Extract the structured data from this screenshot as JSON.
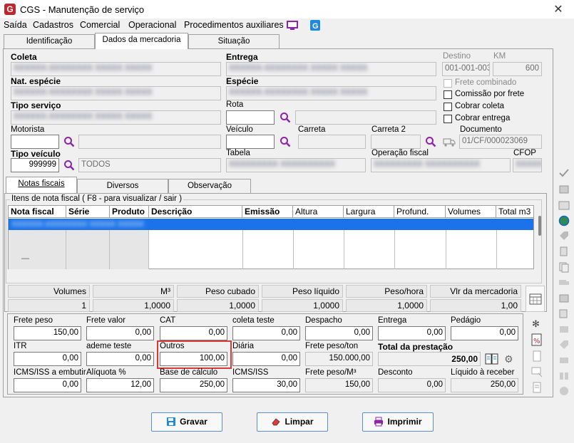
{
  "window": {
    "title": "CGS - Manutenção de serviço",
    "close": "✕",
    "app_icon_letter": "G"
  },
  "menu": [
    "Saída",
    "Cadastros",
    "Comercial",
    "Operacional",
    "Procedimentos auxiliares"
  ],
  "tabs_top": [
    "Identificação",
    "Dados da mercadoria",
    "Situação"
  ],
  "fields": {
    "coleta": "Coleta",
    "entrega": "Entrega",
    "destino": "Destino",
    "destino_value": "001-001-003",
    "km": "KM",
    "km_value": "600",
    "nat_especie": "Nat. espécie",
    "especie": "Espécie",
    "tipo_servico": "Tipo serviço",
    "rota": "Rota",
    "motorista": "Motorista",
    "veiculo": "Veículo",
    "carreta": "Carreta",
    "carreta2": "Carreta 2",
    "documento": "Documento",
    "documento_value": "01/CF/000023069",
    "tipo_veiculo": "Tipo veículo",
    "tipo_veiculo_code": "999999",
    "tipo_veiculo_desc": "TODOS",
    "tabela": "Tabela",
    "operacao_fiscal": "Operação fiscal",
    "cfop": "CFOP"
  },
  "checks": [
    "Frete combinado",
    "Comissão por frete",
    "Cobrar coleta",
    "Cobrar entrega"
  ],
  "tabs_mid": [
    "Notas fiscais",
    "Diversos",
    "Observação"
  ],
  "group_title": "Itens de nota fiscal ( F8 - para visualizar / sair )",
  "grid_headers": [
    "Nota fiscal",
    "Série",
    "Produto",
    "Descrição",
    "Emissão",
    "Altura",
    "Largura",
    "Profund.",
    "Volumes",
    "Total m3"
  ],
  "grid_footer": "—",
  "summary": {
    "labels": [
      "Volumes",
      "M³",
      "Peso cubado",
      "Peso líquido",
      "Peso/hora",
      "Vlr da mercadoria"
    ],
    "values": [
      "1",
      "1,0000",
      "1,0000",
      "1,0000",
      "1,0000",
      "1,00"
    ]
  },
  "charges": {
    "frete_peso": {
      "label": "Frete peso",
      "value": "150,00"
    },
    "frete_valor": {
      "label": "Frete valor",
      "value": "0,00"
    },
    "cat": {
      "label": "CAT",
      "value": "0,00"
    },
    "coleta_teste": {
      "label": "coleta teste",
      "value": "0,00"
    },
    "despacho": {
      "label": "Despacho",
      "value": "0,00"
    },
    "entrega": {
      "label": "Entrega",
      "value": "0,00"
    },
    "pedagio": {
      "label": "Pedágio",
      "value": "0,00"
    },
    "itr": {
      "label": "ITR",
      "value": "0,00"
    },
    "ademe_teste": {
      "label": "ademe teste",
      "value": "0,00"
    },
    "outros": {
      "label": "Outros",
      "value": "100,00"
    },
    "diaria": {
      "label": "Diária",
      "value": "0,00"
    },
    "frete_peso_ton": {
      "label": "Frete peso/ton",
      "value": "150.000,00"
    },
    "total_prestacao": {
      "label": "Total da prestação",
      "value": "250,00"
    },
    "icms_embutir": {
      "label": "ICMS/ISS a embutir",
      "value": "0,00"
    },
    "aliquota": {
      "label": "Alíquota %",
      "value": "12,00"
    },
    "base_calculo": {
      "label": "Base de cálculo",
      "value": "250,00"
    },
    "icms_iss": {
      "label": "ICMS/ISS",
      "value": "30,00"
    },
    "frete_peso_m3": {
      "label": "Frete peso/M³",
      "value": "150,00"
    },
    "desconto": {
      "label": "Desconto",
      "value": "0,00"
    },
    "liquido": {
      "label": "Líquido à receber",
      "value": "250,00"
    }
  },
  "buttons": {
    "gravar": "Gravar",
    "limpar": "Limpar",
    "imprimir": "Imprimir"
  },
  "blurred": {
    "row": "XXXXXX-XXXXXXXX XXXXX XXXXX",
    "short": "XXXXX",
    "desc": "XXXXXXXXX XXXXXXXXXX"
  },
  "colors": {
    "accent": "#1a73e8",
    "highlight_border": "#d93a3a",
    "app_icon": "#c0262d"
  }
}
